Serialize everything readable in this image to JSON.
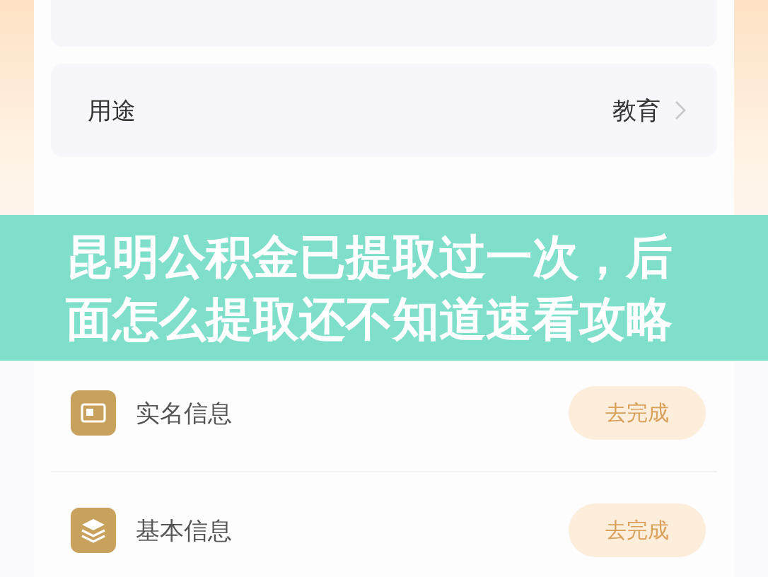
{
  "settings_rows": [
    {
      "label": "用途",
      "value": "教育"
    }
  ],
  "tasks": [
    {
      "label": "实名信息",
      "kind": "id-card",
      "button": "去完成"
    },
    {
      "label": "基本信息",
      "kind": "layers",
      "button": "去完成"
    }
  ],
  "banner": {
    "title": "昆明公积金已提取过一次，后面怎么提取还不知道速看攻略"
  }
}
